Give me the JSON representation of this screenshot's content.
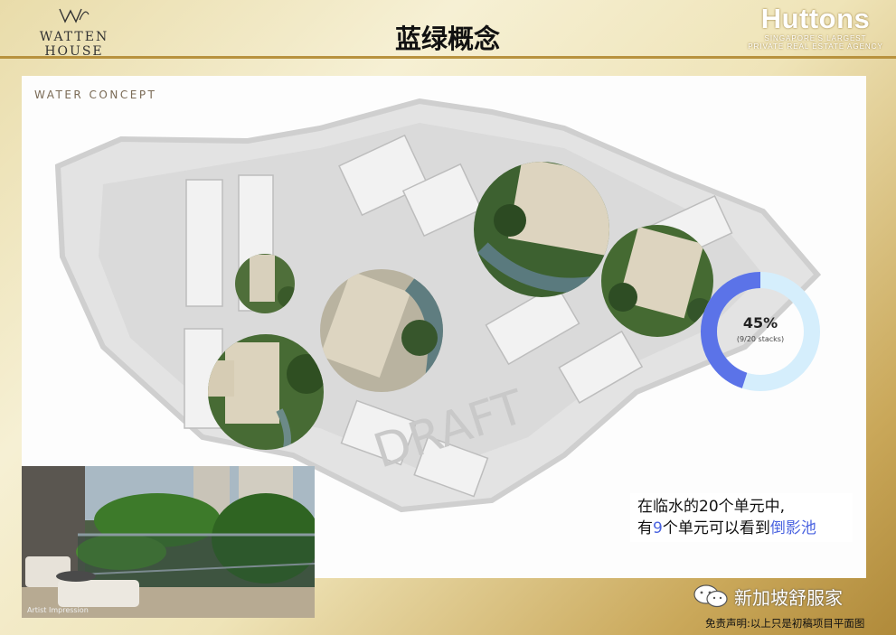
{
  "header": {
    "brand_logo_text": "WATTEN HOUSE",
    "title": "蓝绿概念",
    "agency_name": "Huttons",
    "agency_tagline_1": "SINGAPORE'S LARGEST",
    "agency_tagline_2": "PRIVATE REAL ESTATE AGENCY"
  },
  "plan": {
    "label": "WATER CONCEPT",
    "watermark": "DRAFT"
  },
  "stat": {
    "percent_label": "45%",
    "detail": "(9/20 stacks)",
    "fraction": 0.45,
    "colors": {
      "filled": "#5b73e8",
      "remaining": "#d5eefc"
    }
  },
  "note": {
    "line1": "在临水的20个单元中,",
    "line2_pre": "有",
    "line2_num": "9",
    "line2_mid": "个单元可以看到",
    "line2_hl": "倒影池"
  },
  "photo": {
    "caption": "Artist Impression"
  },
  "footer": {
    "wechat_name": "新加坡舒服家",
    "disclaimer": "免责声明:以上只是初稿项目平面图"
  },
  "colors": {
    "accent_gold": "#b8923e",
    "highlight_blue": "#4a63e0"
  }
}
